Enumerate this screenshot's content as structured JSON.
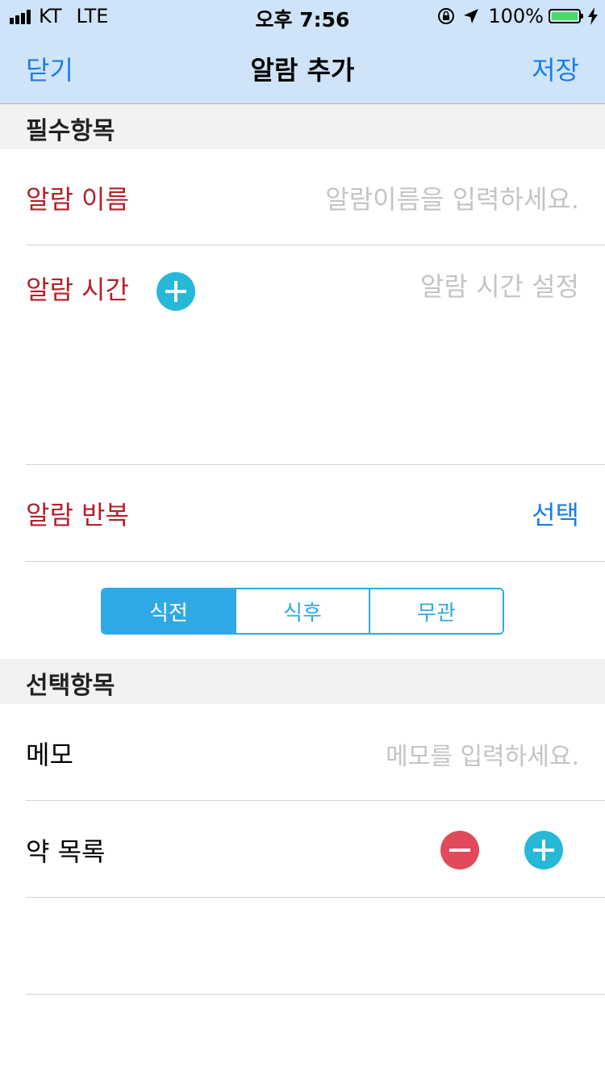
{
  "status_bar": {
    "carrier": "KT",
    "network": "LTE",
    "time": "오후 7:56",
    "battery_percent": "100%",
    "battery_level": 1.0,
    "icons": [
      "signal-icon",
      "orientation-lock-icon",
      "location-arrow-icon",
      "battery-icon",
      "charging-bolt-icon"
    ]
  },
  "nav": {
    "close_label": "닫기",
    "title": "알람 추가",
    "save_label": "저장"
  },
  "required_section": {
    "header": "필수항목",
    "alarm_name": {
      "label": "알람 이름",
      "placeholder": "알람이름을 입력하세요."
    },
    "alarm_time": {
      "label": "알람 시간",
      "placeholder": "알람 시간 설정",
      "add_icon": "plus-circle-icon"
    },
    "alarm_repeat": {
      "label": "알람 반복",
      "action": "선택"
    },
    "meal_timing": {
      "options": [
        "식전",
        "식후",
        "무관"
      ],
      "selected_index": 0
    }
  },
  "optional_section": {
    "header": "선택항목",
    "memo": {
      "label": "메모",
      "placeholder": "메모를 입력하세요."
    },
    "medicine_list": {
      "label": "약 목록",
      "remove_icon": "minus-circle-icon",
      "add_icon": "plus-circle-icon"
    }
  },
  "colors": {
    "bar_background": "#cfe4f8",
    "accent_blue": "#1a7ee6",
    "required_red": "#b3202a",
    "segment_blue": "#2fa9e6",
    "add_teal": "#27b8d8",
    "remove_red": "#e04a5a",
    "battery_green": "#4cd964"
  }
}
